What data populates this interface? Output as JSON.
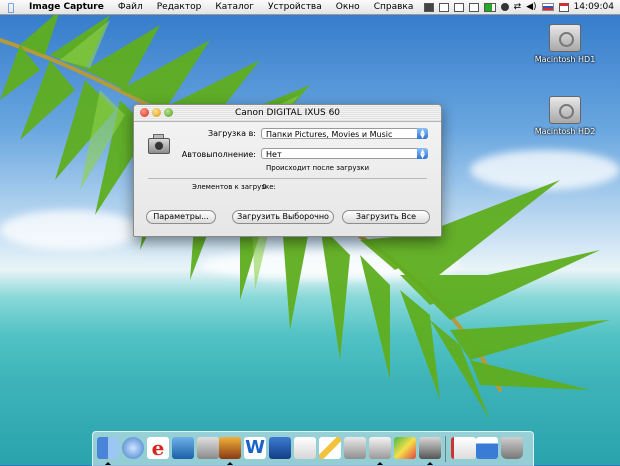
{
  "menubar": {
    "app_name": "Image Capture",
    "items": [
      "Файл",
      "Редактор",
      "Каталог",
      "Устройства",
      "Окно",
      "Справка"
    ],
    "clock": "14:09:04",
    "extras_icons": [
      "screen-icon",
      "mail-icon",
      "checkbox-icon",
      "add-icon",
      "battery-icon",
      "record-icon",
      "sync-icon",
      "volume-icon",
      "flag-ru-icon",
      "calendar-icon"
    ]
  },
  "desktop": {
    "hd1": "Macintosh HD1",
    "hd2": "Macintosh HD2"
  },
  "window": {
    "title": "Canon DIGITAL IXUS 60",
    "download_label": "Загрузка в:",
    "download_value": "Папки Pictures, Movies и Music",
    "autorun_label": "Автовыполнение:",
    "autorun_value": "Нет",
    "autorun_note": "Происходит после загрузки",
    "items_label": "Элементов к загрузке:",
    "items_count": "0",
    "btn_options": "Параметры...",
    "btn_download_selected": "Загрузить Выборочно",
    "btn_download_all": "Загрузить Все"
  },
  "dock": {
    "items": [
      "finder-icon",
      "network-icon",
      "browser-icon",
      "ftp-icon",
      "tool-icon",
      "photo-icon",
      "word-icon",
      "book-icon",
      "notepad-icon",
      "pencil-icon",
      "printer-icon",
      "wireless-icon",
      "paint-icon",
      "camera-icon",
      "document-icon",
      "calendar-icon",
      "trash-icon"
    ]
  }
}
